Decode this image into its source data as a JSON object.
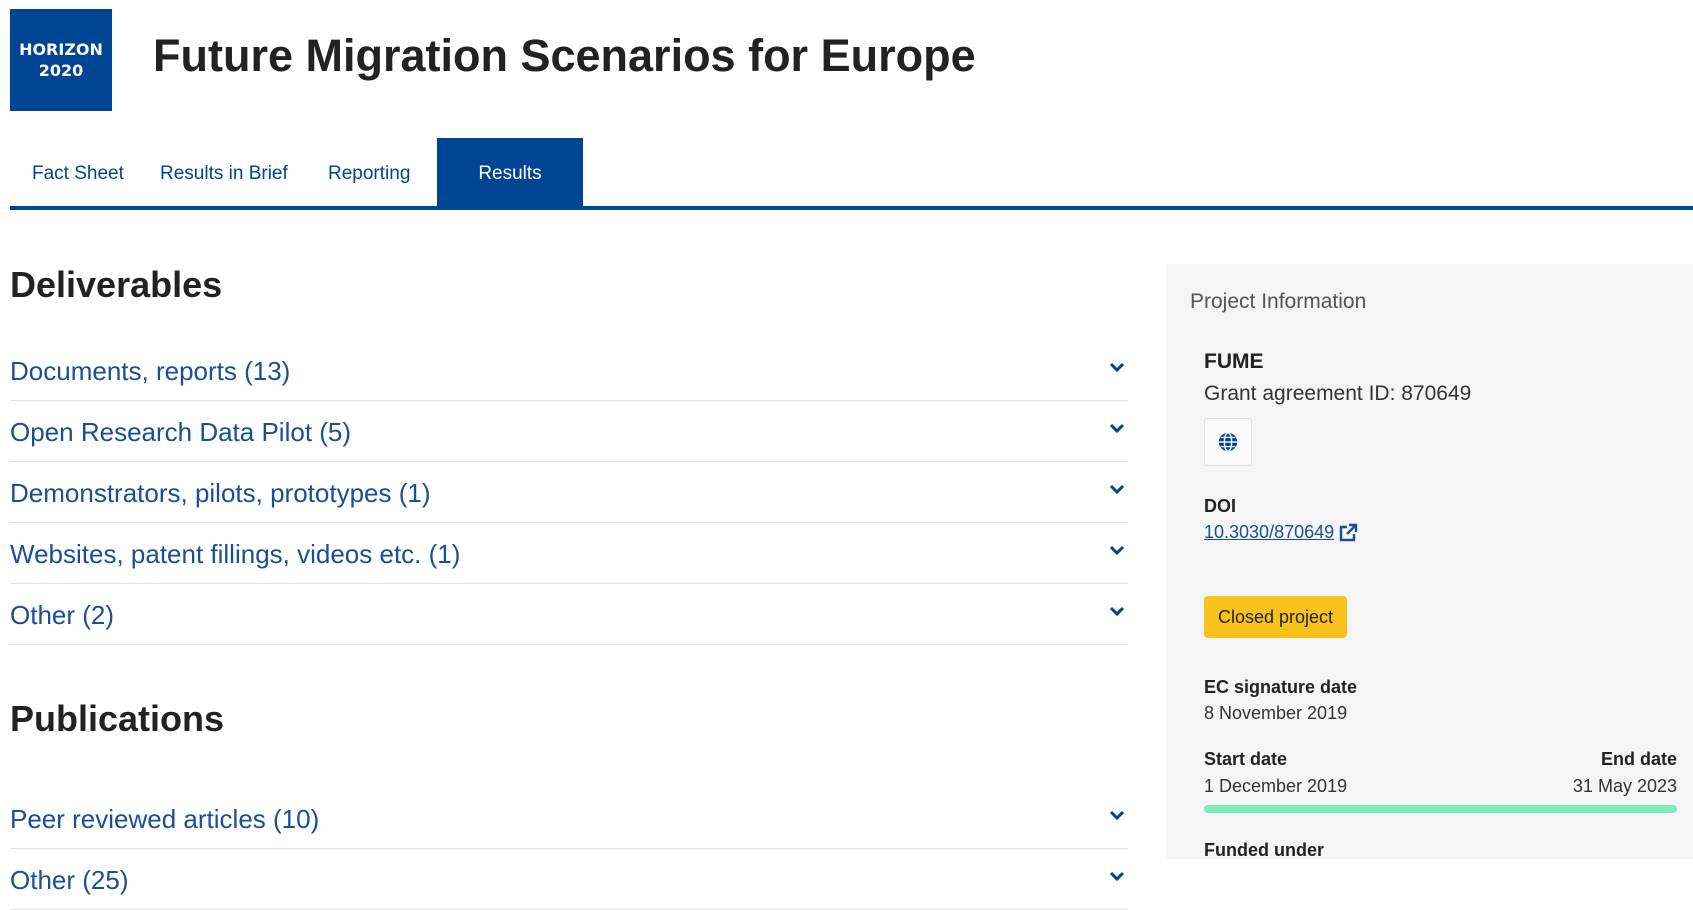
{
  "logo": {
    "line1": "HORIZON",
    "line2": "2020"
  },
  "page_title": "Future Migration Scenarios for Europe",
  "tabs": [
    {
      "label": "Fact Sheet"
    },
    {
      "label": "Results in Brief"
    },
    {
      "label": "Reporting"
    },
    {
      "label": "Results",
      "active": true
    }
  ],
  "deliverables": {
    "heading": "Deliverables",
    "items": [
      {
        "label": "Documents, reports (13)"
      },
      {
        "label": "Open Research Data Pilot (5)"
      },
      {
        "label": "Demonstrators, pilots, prototypes (1)"
      },
      {
        "label": "Websites, patent fillings, videos etc. (1)"
      },
      {
        "label": "Other (2)"
      }
    ]
  },
  "publications": {
    "heading": "Publications",
    "items": [
      {
        "label": "Peer reviewed articles (10)"
      },
      {
        "label": "Other (25)"
      }
    ]
  },
  "project_info": {
    "heading": "Project Information",
    "acronym": "FUME",
    "grant_id": "Grant agreement ID: 870649",
    "website_icon": "globe-icon",
    "doi_label": "DOI",
    "doi_value": "10.3030/870649",
    "status": "Closed project",
    "ec_signature_label": "EC signature date",
    "ec_signature_date": "8 November 2019",
    "start_label": "Start date",
    "start_date": "1 December 2019",
    "end_label": "End date",
    "end_date": "31 May 2023",
    "progress": 1.0,
    "funded_label": "Funded under"
  },
  "colors": {
    "brand": "#004494",
    "link": "#1a4e96",
    "status": "#f9c21a",
    "progress": "#7eedb9"
  }
}
